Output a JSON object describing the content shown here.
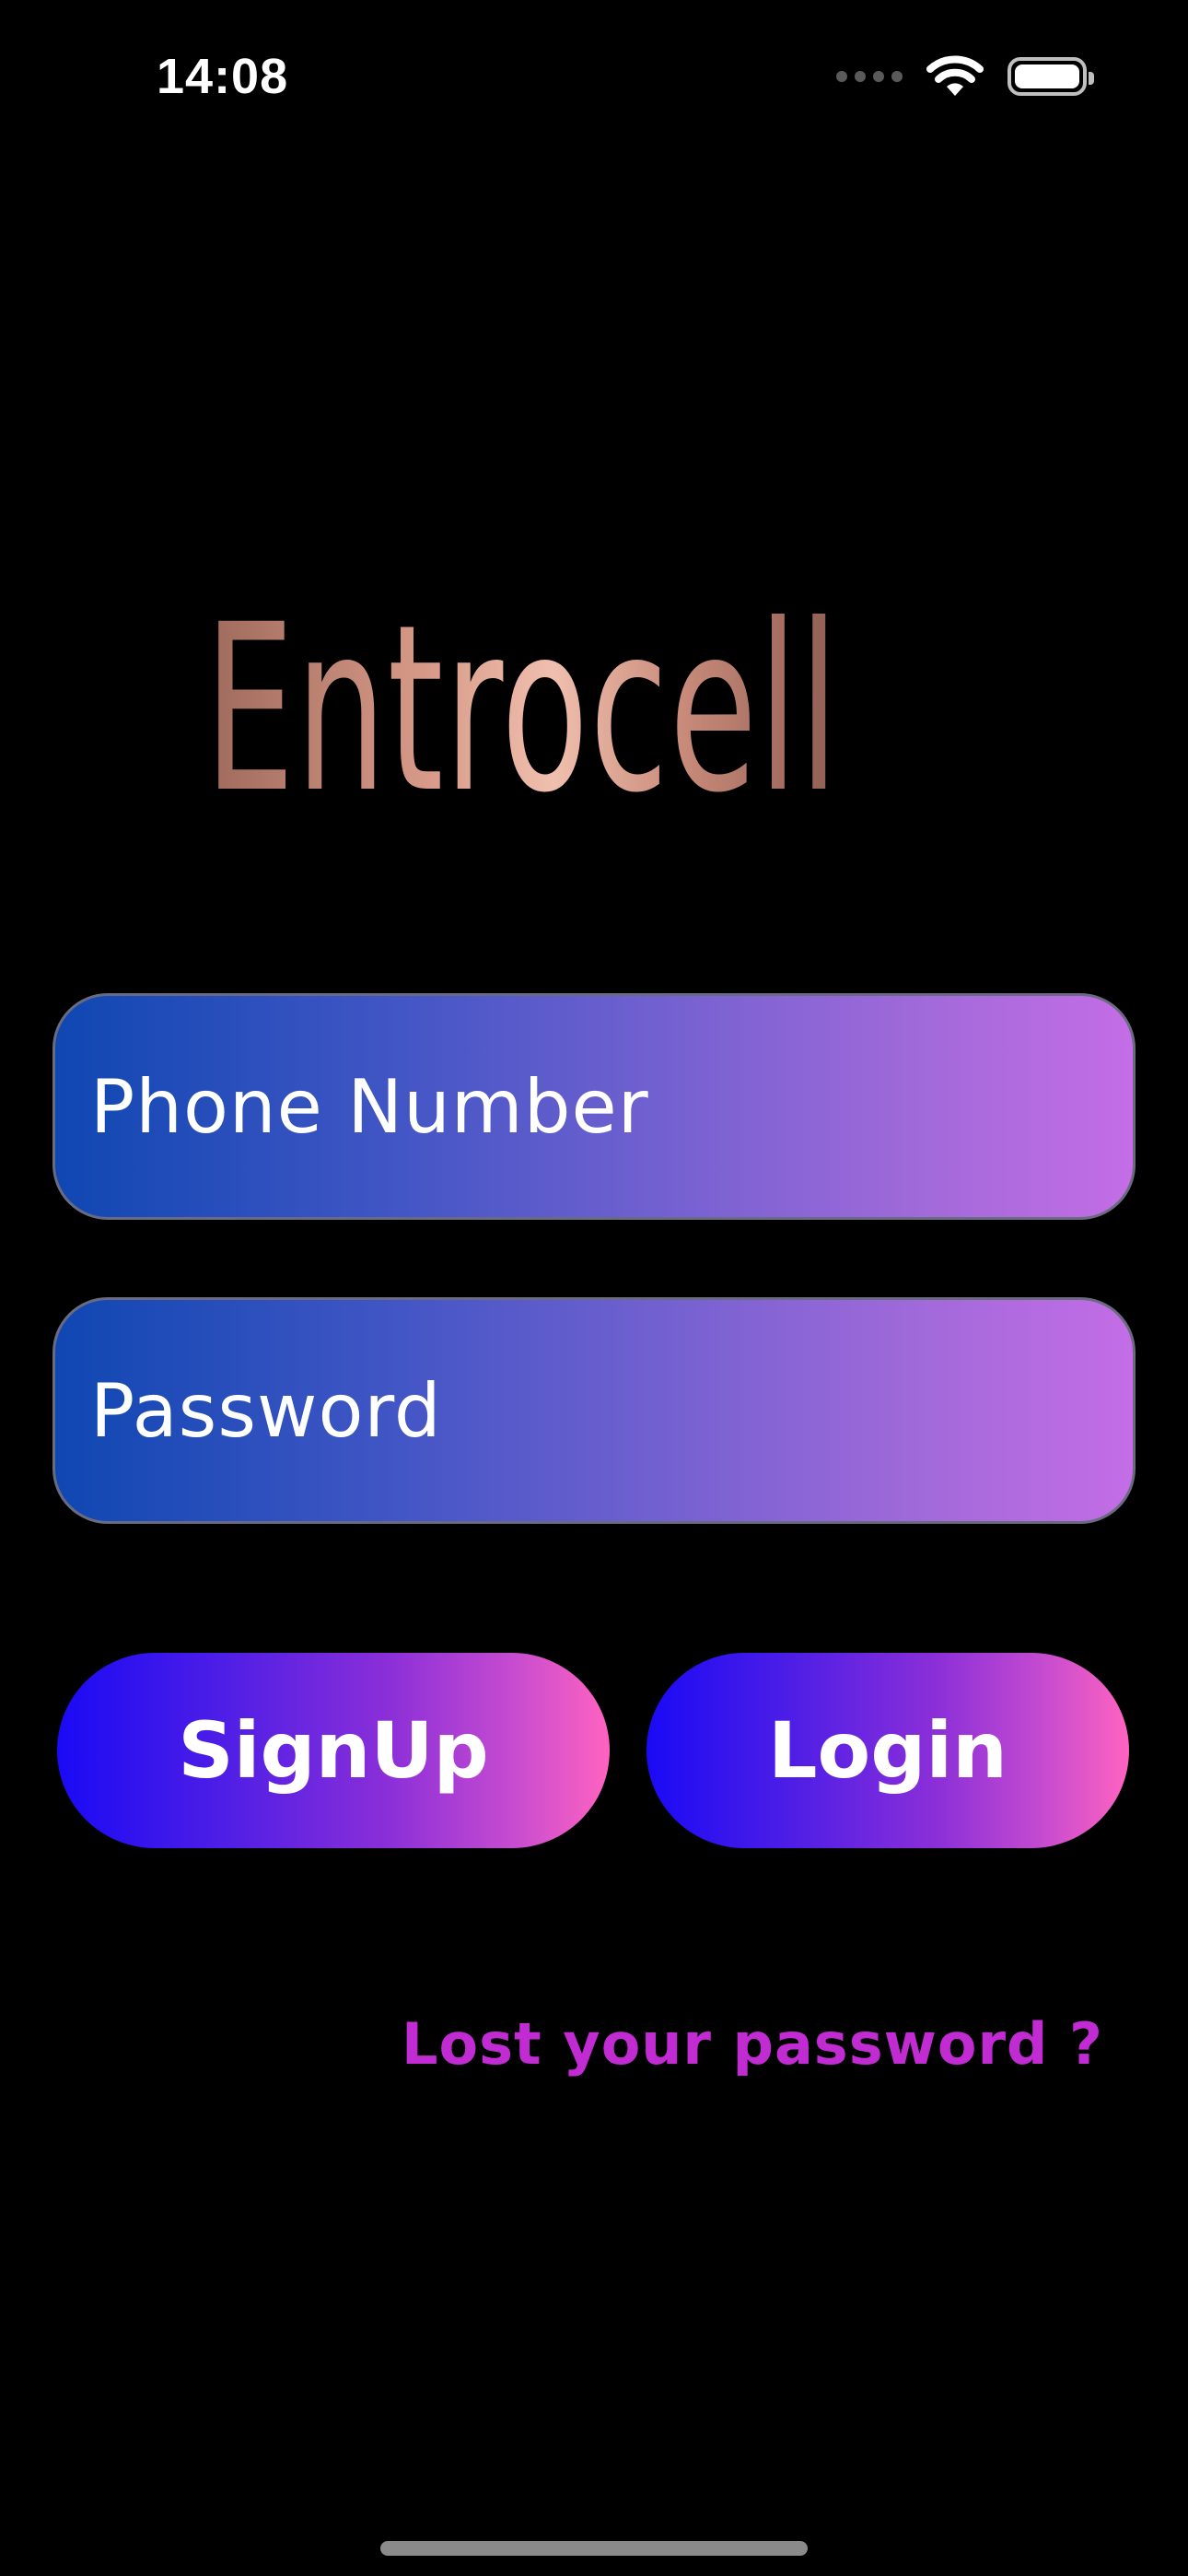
{
  "status_bar": {
    "time": "14:08",
    "icons": [
      "signal-dots-icon",
      "wifi-icon",
      "battery-icon"
    ]
  },
  "logo": {
    "brand_name": "Entrocell",
    "mark_icon": "entrocell-logo-mark",
    "colors": {
      "rose_gold_light": "#f0bfae",
      "rose_gold_dark": "#9e6a5c"
    }
  },
  "form": {
    "phone_placeholder": "Phone Number",
    "phone_value": "",
    "password_placeholder": "Password",
    "password_value": ""
  },
  "buttons": {
    "signup_label": "SignUp",
    "login_label": "Login"
  },
  "links": {
    "lost_password": "Lost your password ?"
  },
  "colors": {
    "background": "#000000",
    "field_gradient_start": "#0f47b2",
    "field_gradient_end": "#c46de6",
    "button_gradient_start": "#1a0af5",
    "button_gradient_end": "#ff63c0",
    "link": "#c02bd2"
  }
}
